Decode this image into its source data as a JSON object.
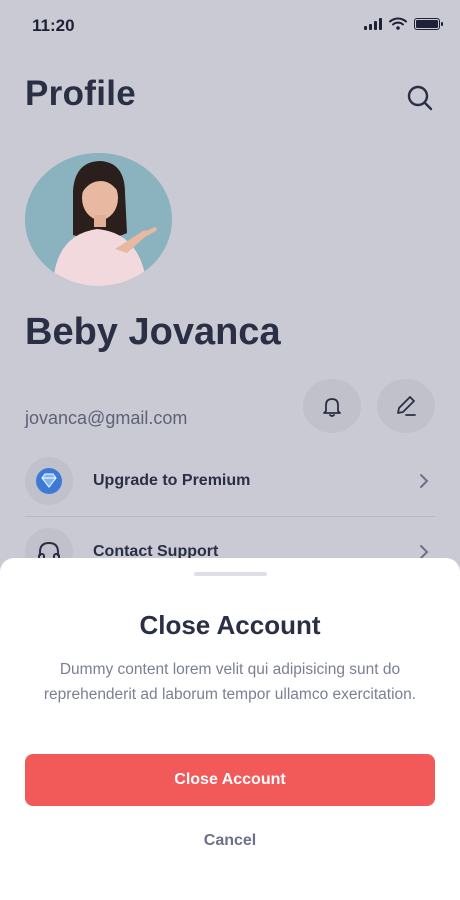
{
  "status_bar": {
    "time": "11:20",
    "icons": [
      "signal-icon",
      "wifi-icon",
      "battery-icon"
    ]
  },
  "header": {
    "title": "Profile",
    "search_icon": "search-icon"
  },
  "profile": {
    "name": "Beby Jovanca",
    "email": "jovanca@gmail.com"
  },
  "actions": {
    "notifications_icon": "bell-icon",
    "edit_icon": "pencil-icon"
  },
  "menu": {
    "items": [
      {
        "label": "Upgrade to Premium",
        "icon": "diamond-icon"
      },
      {
        "label": "Contact Support",
        "icon": "headphones-icon"
      }
    ]
  },
  "sheet": {
    "title": "Close Account",
    "description": "Dummy content lorem velit qui adipisicing sunt do reprehenderit ad laborum tempor ullamco exercitation.",
    "primary_label": "Close Account",
    "cancel_label": "Cancel"
  },
  "colors": {
    "background_dim": "#c9cad3",
    "text_dark": "#2b2f45",
    "danger": "#f25a5a",
    "sheet_bg": "#ffffff"
  }
}
